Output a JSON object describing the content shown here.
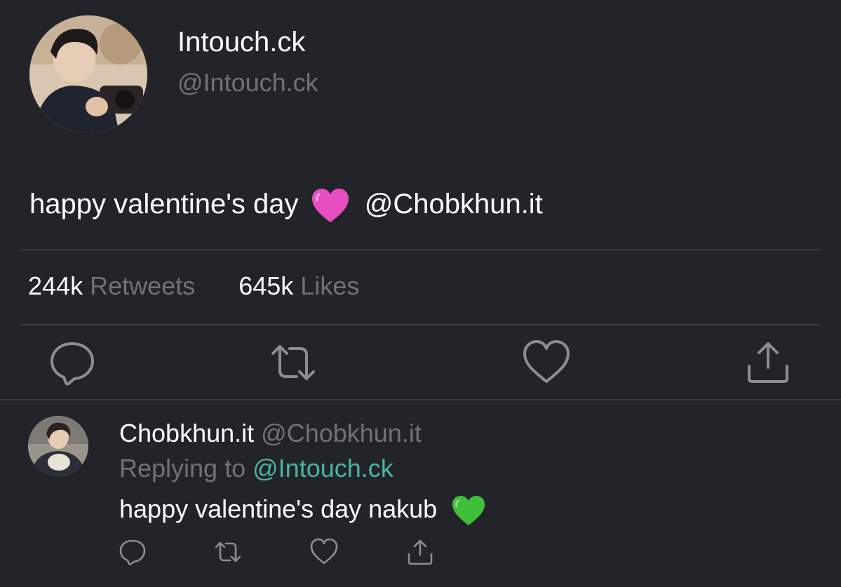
{
  "tweet": {
    "author": {
      "display_name": "Intouch.ck",
      "handle": "@Intouch.ck"
    },
    "text_before_emoji": "happy valentine's day",
    "emoji": "pink-heart",
    "mention": "@Chobkhun.it",
    "stats": {
      "retweets_count": "244k",
      "retweets_label": "Retweets",
      "likes_count": "645k",
      "likes_label": "Likes"
    },
    "actions": [
      "reply-icon",
      "retweet-icon",
      "like-heart-icon",
      "share-icon"
    ]
  },
  "reply": {
    "display_name": "Chobkhun.it",
    "handle": "@Chobkhun.it",
    "replying_prefix": "Replying to",
    "replying_to": "@Intouch.ck",
    "text": "happy valentine's day nakub",
    "emoji": "green-heart",
    "actions": [
      "reply-icon",
      "retweet-icon",
      "like-heart-icon",
      "share-icon"
    ]
  },
  "colors": {
    "background": "#232429",
    "text_primary": "#ffffff",
    "text_secondary": "#6f7279",
    "mention_accent": "#4ab3a4",
    "divider": "#3b3c42",
    "icon": "#8b8e95",
    "pink_heart": "#e64fc0",
    "green_heart": "#3fbf3a"
  }
}
